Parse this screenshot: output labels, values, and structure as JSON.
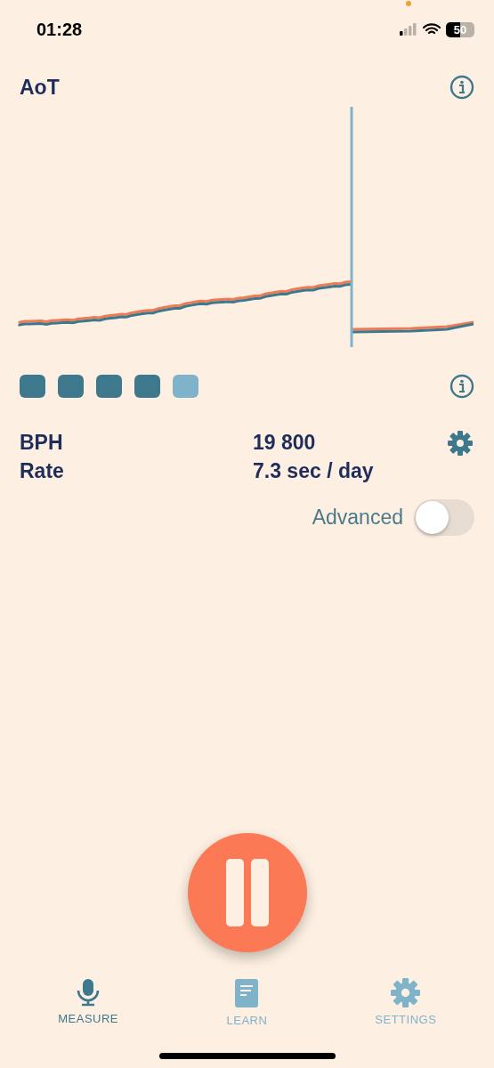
{
  "status_bar": {
    "time": "01:28",
    "battery": "50"
  },
  "header": {
    "title": "AoT"
  },
  "quality_squares": [
    {
      "filled": true
    },
    {
      "filled": true
    },
    {
      "filled": true
    },
    {
      "filled": true
    },
    {
      "filled": false
    }
  ],
  "readings": [
    {
      "label": "BPH",
      "value": "19 800"
    },
    {
      "label": "Rate",
      "value": "7.3 sec / day"
    }
  ],
  "advanced": {
    "label": "Advanced",
    "on": false
  },
  "recording": {
    "paused": false
  },
  "tabs": [
    {
      "kind": "measure",
      "label": "MEASURE",
      "selected": true
    },
    {
      "kind": "learn",
      "label": "LEARN",
      "selected": false
    },
    {
      "kind": "settings",
      "label": "SETTINGS",
      "selected": false
    }
  ]
}
